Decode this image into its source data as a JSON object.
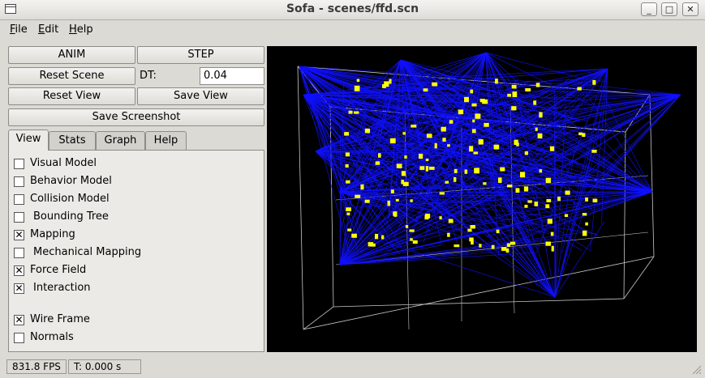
{
  "window": {
    "title": "Sofa - scenes/ffd.scn",
    "minimize": "_",
    "maximize": "□",
    "close": "✕"
  },
  "menu": [
    {
      "accel": "F",
      "rest": "ile"
    },
    {
      "accel": "E",
      "rest": "dit"
    },
    {
      "accel": "H",
      "rest": "elp"
    }
  ],
  "controls": {
    "anim": "ANIM",
    "step": "STEP",
    "reset_scene": "Reset Scene",
    "dt_label": "DT:",
    "dt_value": "0.04",
    "reset_view": "Reset View",
    "save_view": "Save View",
    "save_screenshot": "Save Screenshot"
  },
  "tabs": [
    "View",
    "Stats",
    "Graph",
    "Help"
  ],
  "view_options": [
    {
      "label": "Visual Model",
      "checked": false
    },
    {
      "label": "Behavior Model",
      "checked": false
    },
    {
      "label": "Collision Model",
      "checked": false
    },
    {
      "label": " Bounding Tree",
      "checked": false
    },
    {
      "label": "Mapping",
      "checked": true
    },
    {
      "label": " Mechanical Mapping",
      "checked": false
    },
    {
      "label": "Force Field",
      "checked": true
    },
    {
      "label": " Interaction",
      "checked": true
    },
    {
      "label": "Wire Frame",
      "checked": true
    },
    {
      "label": "Normals",
      "checked": false
    }
  ],
  "status": {
    "fps": "831.8 FPS",
    "time": "T: 0.000 s"
  },
  "colors": {
    "wire": "#1010ff",
    "points": "#ffff00",
    "grid": "#c8c8c8",
    "viewport_bg": "#000000"
  }
}
